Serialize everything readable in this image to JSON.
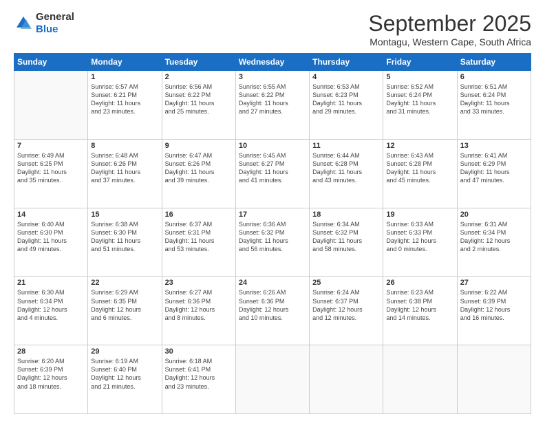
{
  "logo": {
    "general": "General",
    "blue": "Blue"
  },
  "header": {
    "title": "September 2025",
    "location": "Montagu, Western Cape, South Africa"
  },
  "days": [
    "Sunday",
    "Monday",
    "Tuesday",
    "Wednesday",
    "Thursday",
    "Friday",
    "Saturday"
  ],
  "weeks": [
    [
      {
        "day": "",
        "info": ""
      },
      {
        "day": "1",
        "info": "Sunrise: 6:57 AM\nSunset: 6:21 PM\nDaylight: 11 hours\nand 23 minutes."
      },
      {
        "day": "2",
        "info": "Sunrise: 6:56 AM\nSunset: 6:22 PM\nDaylight: 11 hours\nand 25 minutes."
      },
      {
        "day": "3",
        "info": "Sunrise: 6:55 AM\nSunset: 6:22 PM\nDaylight: 11 hours\nand 27 minutes."
      },
      {
        "day": "4",
        "info": "Sunrise: 6:53 AM\nSunset: 6:23 PM\nDaylight: 11 hours\nand 29 minutes."
      },
      {
        "day": "5",
        "info": "Sunrise: 6:52 AM\nSunset: 6:24 PM\nDaylight: 11 hours\nand 31 minutes."
      },
      {
        "day": "6",
        "info": "Sunrise: 6:51 AM\nSunset: 6:24 PM\nDaylight: 11 hours\nand 33 minutes."
      }
    ],
    [
      {
        "day": "7",
        "info": "Sunrise: 6:49 AM\nSunset: 6:25 PM\nDaylight: 11 hours\nand 35 minutes."
      },
      {
        "day": "8",
        "info": "Sunrise: 6:48 AM\nSunset: 6:26 PM\nDaylight: 11 hours\nand 37 minutes."
      },
      {
        "day": "9",
        "info": "Sunrise: 6:47 AM\nSunset: 6:26 PM\nDaylight: 11 hours\nand 39 minutes."
      },
      {
        "day": "10",
        "info": "Sunrise: 6:45 AM\nSunset: 6:27 PM\nDaylight: 11 hours\nand 41 minutes."
      },
      {
        "day": "11",
        "info": "Sunrise: 6:44 AM\nSunset: 6:28 PM\nDaylight: 11 hours\nand 43 minutes."
      },
      {
        "day": "12",
        "info": "Sunrise: 6:43 AM\nSunset: 6:28 PM\nDaylight: 11 hours\nand 45 minutes."
      },
      {
        "day": "13",
        "info": "Sunrise: 6:41 AM\nSunset: 6:29 PM\nDaylight: 11 hours\nand 47 minutes."
      }
    ],
    [
      {
        "day": "14",
        "info": "Sunrise: 6:40 AM\nSunset: 6:30 PM\nDaylight: 11 hours\nand 49 minutes."
      },
      {
        "day": "15",
        "info": "Sunrise: 6:38 AM\nSunset: 6:30 PM\nDaylight: 11 hours\nand 51 minutes."
      },
      {
        "day": "16",
        "info": "Sunrise: 6:37 AM\nSunset: 6:31 PM\nDaylight: 11 hours\nand 53 minutes."
      },
      {
        "day": "17",
        "info": "Sunrise: 6:36 AM\nSunset: 6:32 PM\nDaylight: 11 hours\nand 56 minutes."
      },
      {
        "day": "18",
        "info": "Sunrise: 6:34 AM\nSunset: 6:32 PM\nDaylight: 11 hours\nand 58 minutes."
      },
      {
        "day": "19",
        "info": "Sunrise: 6:33 AM\nSunset: 6:33 PM\nDaylight: 12 hours\nand 0 minutes."
      },
      {
        "day": "20",
        "info": "Sunrise: 6:31 AM\nSunset: 6:34 PM\nDaylight: 12 hours\nand 2 minutes."
      }
    ],
    [
      {
        "day": "21",
        "info": "Sunrise: 6:30 AM\nSunset: 6:34 PM\nDaylight: 12 hours\nand 4 minutes."
      },
      {
        "day": "22",
        "info": "Sunrise: 6:29 AM\nSunset: 6:35 PM\nDaylight: 12 hours\nand 6 minutes."
      },
      {
        "day": "23",
        "info": "Sunrise: 6:27 AM\nSunset: 6:36 PM\nDaylight: 12 hours\nand 8 minutes."
      },
      {
        "day": "24",
        "info": "Sunrise: 6:26 AM\nSunset: 6:36 PM\nDaylight: 12 hours\nand 10 minutes."
      },
      {
        "day": "25",
        "info": "Sunrise: 6:24 AM\nSunset: 6:37 PM\nDaylight: 12 hours\nand 12 minutes."
      },
      {
        "day": "26",
        "info": "Sunrise: 6:23 AM\nSunset: 6:38 PM\nDaylight: 12 hours\nand 14 minutes."
      },
      {
        "day": "27",
        "info": "Sunrise: 6:22 AM\nSunset: 6:39 PM\nDaylight: 12 hours\nand 16 minutes."
      }
    ],
    [
      {
        "day": "28",
        "info": "Sunrise: 6:20 AM\nSunset: 6:39 PM\nDaylight: 12 hours\nand 18 minutes."
      },
      {
        "day": "29",
        "info": "Sunrise: 6:19 AM\nSunset: 6:40 PM\nDaylight: 12 hours\nand 21 minutes."
      },
      {
        "day": "30",
        "info": "Sunrise: 6:18 AM\nSunset: 6:41 PM\nDaylight: 12 hours\nand 23 minutes."
      },
      {
        "day": "",
        "info": ""
      },
      {
        "day": "",
        "info": ""
      },
      {
        "day": "",
        "info": ""
      },
      {
        "day": "",
        "info": ""
      }
    ]
  ]
}
